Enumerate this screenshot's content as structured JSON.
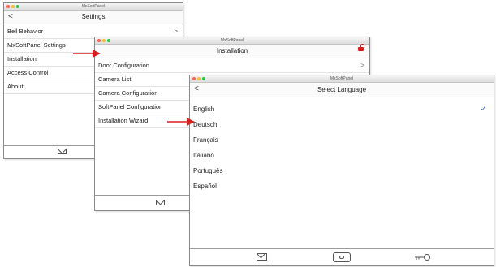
{
  "app_title": "MxSoftPanel",
  "colors": {
    "accent_red": "#d81e1e",
    "check_blue": "#2f7bd6",
    "traffic_red": "#ff5f57",
    "traffic_yellow": "#ffbd2e",
    "traffic_green": "#28c840"
  },
  "settings_window": {
    "title": "MxSoftPanel",
    "header": "Settings",
    "back": "<",
    "items": [
      {
        "label": "Bell Behavior",
        "chevron": ">"
      },
      {
        "label": "MxSoftPanel Settings",
        "chevron": ""
      },
      {
        "label": "Installation",
        "chevron": ""
      },
      {
        "label": "Access Control",
        "chevron": ""
      },
      {
        "label": "About",
        "chevron": ""
      }
    ]
  },
  "installation_window": {
    "title": "MxSoftPanel",
    "header": "Installation",
    "items": [
      {
        "label": "Door Configuration",
        "chevron": ">"
      },
      {
        "label": "Camera List",
        "chevron": ""
      },
      {
        "label": "Camera Configuration",
        "chevron": ""
      },
      {
        "label": "SoftPanel Configuration",
        "chevron": ""
      },
      {
        "label": "Installation Wizard",
        "chevron": ""
      }
    ]
  },
  "language_window": {
    "title": "MxSoftPanel",
    "header": "Select Language",
    "back": "<",
    "check": "✓",
    "selected": "English",
    "items": [
      {
        "label": "English"
      },
      {
        "label": "Deutsch"
      },
      {
        "label": "Français"
      },
      {
        "label": "Italiano"
      },
      {
        "label": "Português"
      },
      {
        "label": "Español"
      }
    ]
  }
}
